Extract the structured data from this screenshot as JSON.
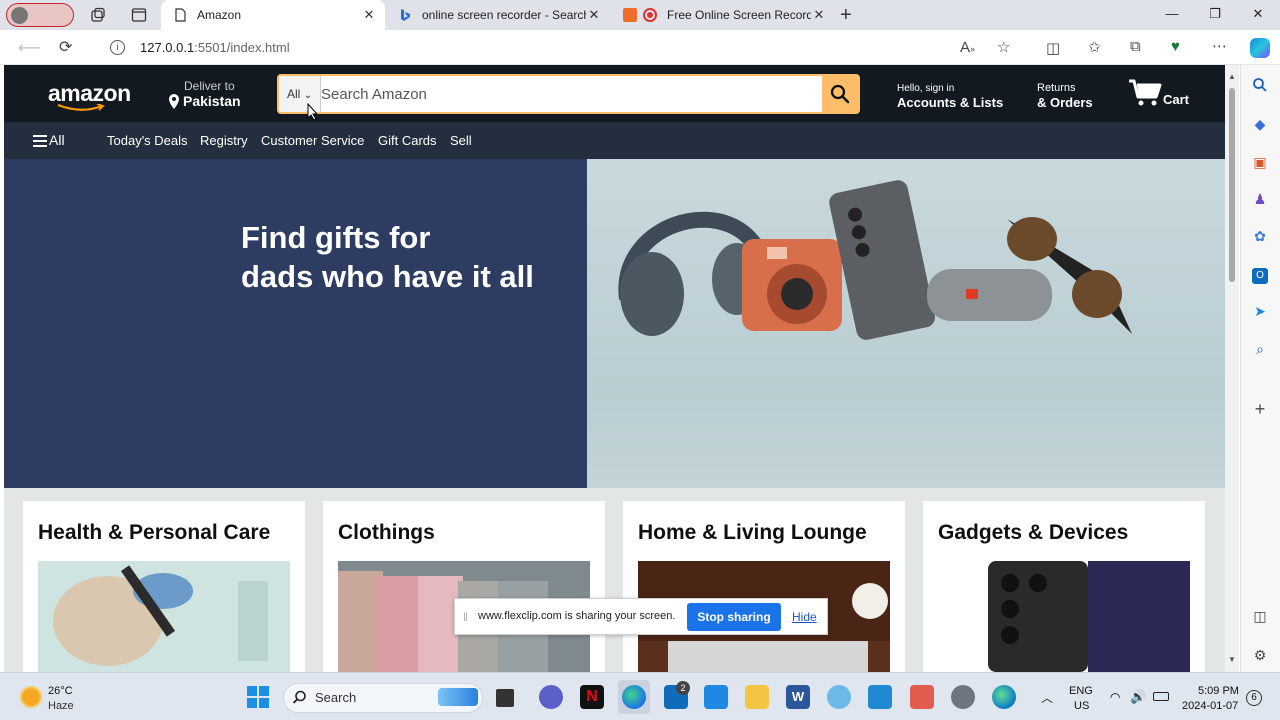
{
  "browser": {
    "tabs": [
      {
        "title": "Amazon",
        "active": true
      },
      {
        "title": "online screen recorder - Search",
        "active": false
      },
      {
        "title": "Free Online Screen Recorder",
        "active": false
      }
    ],
    "url_host": "127.0.0.1",
    "url_path": ":5501/index.html"
  },
  "amazon": {
    "logo": "amazon",
    "deliver_small": "Deliver to",
    "deliver_big": "Pakistan",
    "search_category": "All",
    "search_placeholder": "Search Amazon",
    "account_small": "Hello, sign in",
    "account_big": "Accounts & Lists",
    "returns_small": "Returns",
    "returns_big": "& Orders",
    "cart": "Cart",
    "subnav": {
      "all": "All",
      "items": [
        "Today's Deals",
        "Registry",
        "Customer Service",
        "Gift Cards",
        "Sell"
      ]
    },
    "hero": {
      "line1": "Find gifts for",
      "line2": "dads who have it all"
    },
    "cards": [
      "Health & Personal Care",
      "Clothings",
      "Home & Living Lounge",
      "Gadgets & Devices"
    ]
  },
  "share_banner": {
    "text": "www.flexclip.com is sharing your screen.",
    "stop": "Stop sharing",
    "hide": "Hide"
  },
  "taskbar": {
    "temp": "26°C",
    "weather": "Haze",
    "search": "Search",
    "lang1": "ENG",
    "lang2": "US",
    "time": "5:09 PM",
    "date": "2024-01-07",
    "notif": "6",
    "mail_badge": "2"
  },
  "colors": {
    "amazon_dark": "#131921",
    "amazon_nav": "#232f3e",
    "search_orange": "#febd69",
    "hero_navy": "#2e3c61",
    "share_blue": "#1a73e8"
  }
}
